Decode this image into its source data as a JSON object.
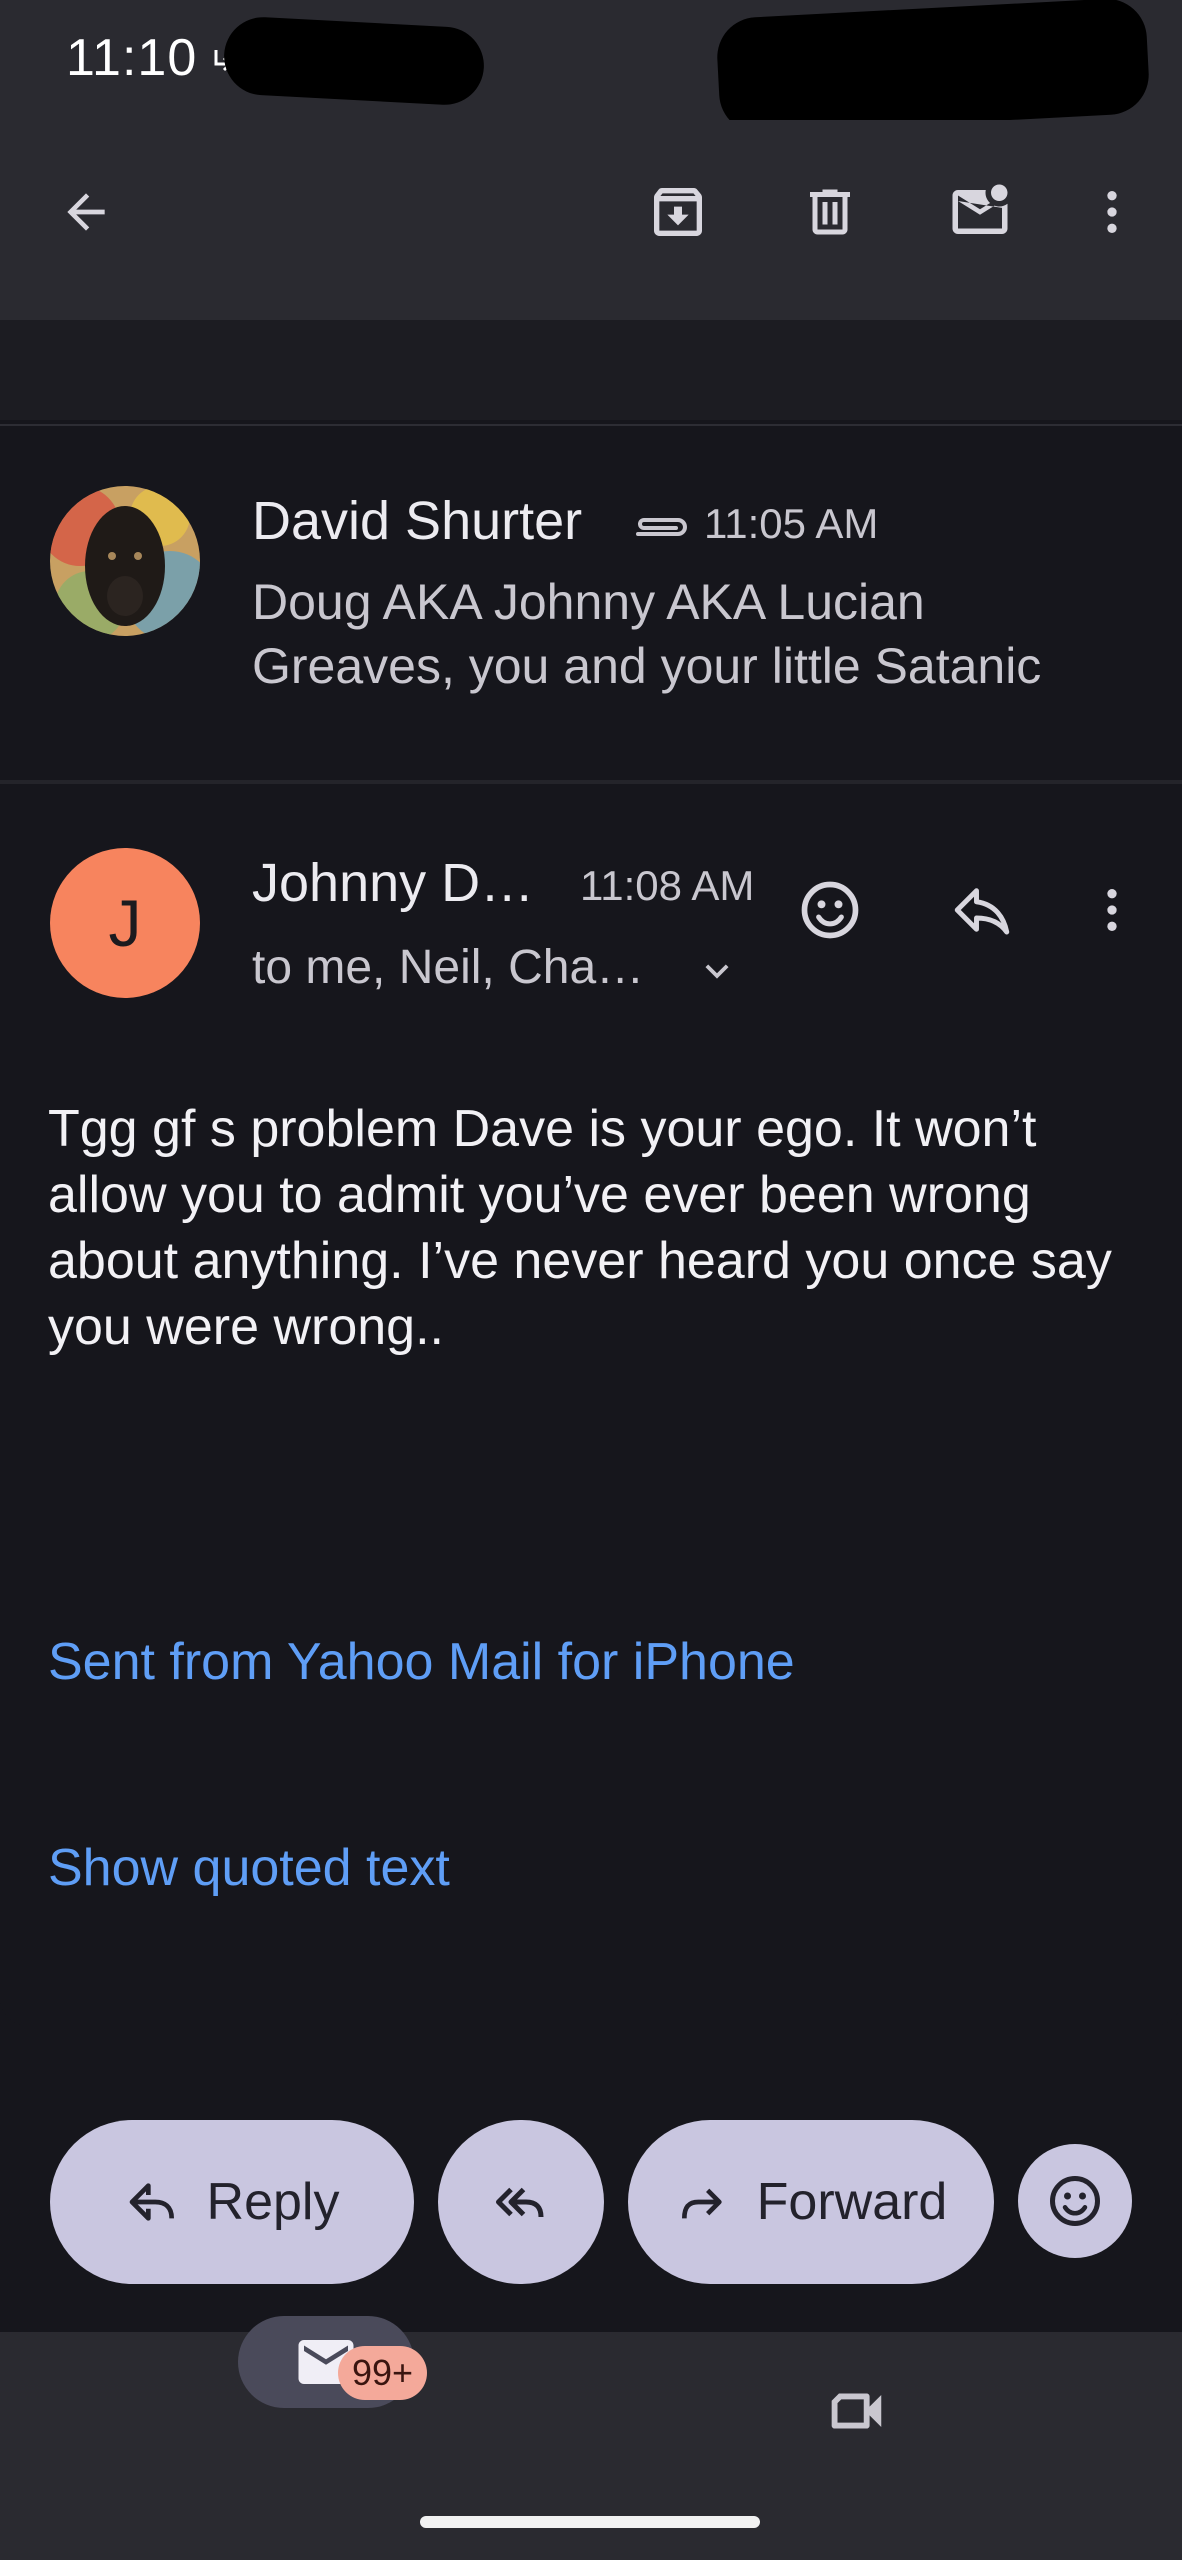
{
  "status_bar": {
    "time": "11:10"
  },
  "app_bar": {
    "icons": [
      "back-arrow-icon",
      "archive-icon",
      "delete-icon",
      "mark-unread-icon",
      "more-vert-icon"
    ]
  },
  "collapsed_message": {
    "sender": "David Shurter",
    "time": "11:05 AM",
    "snippet": "Doug AKA Johnny AKA Lucian Greaves, you and your little Satanic",
    "has_attachment_icon": "paperclip-icon"
  },
  "expanded_message": {
    "avatar_letter": "J",
    "sender": "Johnny D…",
    "time": "11:08 AM",
    "recipients": "to me, Neil, Cha…",
    "body": "Tgg gf s problem Dave is your ego. It won’t allow you to admit you’ve ever been wrong about anything. I’ve never heard you once say you were wrong..",
    "signature_link": "Sent from Yahoo Mail for iPhone",
    "show_quoted": "Show quoted text"
  },
  "actions": {
    "reply": "Reply",
    "forward": "Forward"
  },
  "bottom_nav": {
    "mail_badge": "99+"
  },
  "colors": {
    "background": "#16161c",
    "bar": "#2a2a30",
    "link": "#5f9ef6",
    "avatar_letter_bg": "#f7845e",
    "pill": "#c9c6e0",
    "badge": "#f4a99a"
  }
}
